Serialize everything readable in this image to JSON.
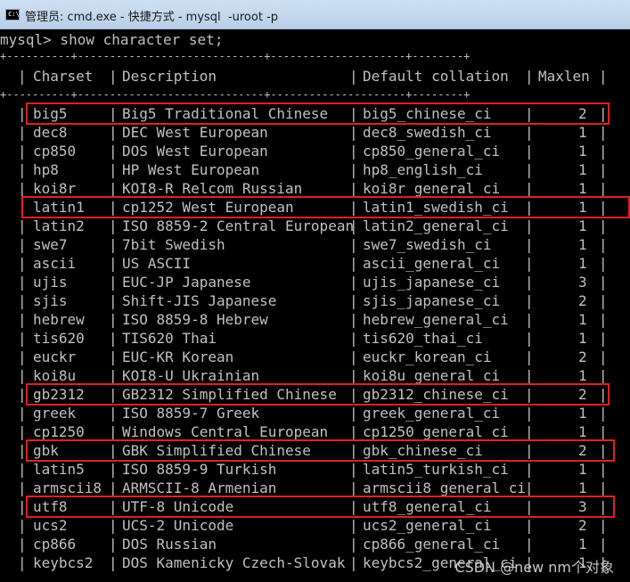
{
  "window": {
    "title_prefix": "管理员: cmd.exe - 快捷方式 - mysql  -uroot -p",
    "icon_text": "C:\\"
  },
  "console": {
    "command_line": "mysql> show character set;",
    "border_line": "+----------+-----------------------------+---------------------+--------+",
    "header": {
      "charset": "Charset",
      "description": "Description",
      "collation": "Default collation",
      "maxlen": "Maxlen"
    },
    "rows": [
      {
        "charset": "big5",
        "description": "Big5 Traditional Chinese",
        "collation": "big5_chinese_ci",
        "maxlen": "2",
        "highlight": true
      },
      {
        "charset": "dec8",
        "description": "DEC West European",
        "collation": "dec8_swedish_ci",
        "maxlen": "1",
        "highlight": false
      },
      {
        "charset": "cp850",
        "description": "DOS West European",
        "collation": "cp850_general_ci",
        "maxlen": "1",
        "highlight": false
      },
      {
        "charset": "hp8",
        "description": "HP West European",
        "collation": "hp8_english_ci",
        "maxlen": "1",
        "highlight": false
      },
      {
        "charset": "koi8r",
        "description": "KOI8-R Relcom Russian",
        "collation": "koi8r_general_ci",
        "maxlen": "1",
        "highlight": false
      },
      {
        "charset": "latin1",
        "description": "cp1252 West European",
        "collation": "latin1_swedish_ci",
        "maxlen": "1",
        "highlight": true
      },
      {
        "charset": "latin2",
        "description": "ISO 8859-2 Central European",
        "collation": "latin2_general_ci",
        "maxlen": "1",
        "highlight": false
      },
      {
        "charset": "swe7",
        "description": "7bit Swedish",
        "collation": "swe7_swedish_ci",
        "maxlen": "1",
        "highlight": false
      },
      {
        "charset": "ascii",
        "description": "US ASCII",
        "collation": "ascii_general_ci",
        "maxlen": "1",
        "highlight": false
      },
      {
        "charset": "ujis",
        "description": "EUC-JP Japanese",
        "collation": "ujis_japanese_ci",
        "maxlen": "3",
        "highlight": false
      },
      {
        "charset": "sjis",
        "description": "Shift-JIS Japanese",
        "collation": "sjis_japanese_ci",
        "maxlen": "2",
        "highlight": false
      },
      {
        "charset": "hebrew",
        "description": "ISO 8859-8 Hebrew",
        "collation": "hebrew_general_ci",
        "maxlen": "1",
        "highlight": false
      },
      {
        "charset": "tis620",
        "description": "TIS620 Thai",
        "collation": "tis620_thai_ci",
        "maxlen": "1",
        "highlight": false
      },
      {
        "charset": "euckr",
        "description": "EUC-KR Korean",
        "collation": "euckr_korean_ci",
        "maxlen": "2",
        "highlight": false
      },
      {
        "charset": "koi8u",
        "description": "KOI8-U Ukrainian",
        "collation": "koi8u_general_ci",
        "maxlen": "1",
        "highlight": false
      },
      {
        "charset": "gb2312",
        "description": "GB2312 Simplified Chinese",
        "collation": "gb2312_chinese_ci",
        "maxlen": "2",
        "highlight": true
      },
      {
        "charset": "greek",
        "description": "ISO 8859-7 Greek",
        "collation": "greek_general_ci",
        "maxlen": "1",
        "highlight": false
      },
      {
        "charset": "cp1250",
        "description": "Windows Central European",
        "collation": "cp1250_general_ci",
        "maxlen": "1",
        "highlight": false
      },
      {
        "charset": "gbk",
        "description": "GBK Simplified Chinese",
        "collation": "gbk_chinese_ci",
        "maxlen": "2",
        "highlight": true
      },
      {
        "charset": "latin5",
        "description": "ISO 8859-9 Turkish",
        "collation": "latin5_turkish_ci",
        "maxlen": "1",
        "highlight": false
      },
      {
        "charset": "armscii8",
        "description": "ARMSCII-8 Armenian",
        "collation": "armscii8_general_ci",
        "maxlen": "1",
        "highlight": false
      },
      {
        "charset": "utf8",
        "description": "UTF-8 Unicode",
        "collation": "utf8_general_ci",
        "maxlen": "3",
        "highlight": true
      },
      {
        "charset": "ucs2",
        "description": "UCS-2 Unicode",
        "collation": "ucs2_general_ci",
        "maxlen": "2",
        "highlight": false
      },
      {
        "charset": "cp866",
        "description": "DOS Russian",
        "collation": "cp866_general_ci",
        "maxlen": "1",
        "highlight": false
      },
      {
        "charset": "keybcs2",
        "description": "DOS Kamenicky Czech-Slovak",
        "collation": "keybcs2_general_ci",
        "maxlen": "1",
        "highlight": false
      }
    ],
    "highlight_color": "#e0201e",
    "text_color": "#c0c0c0",
    "background_color": "#000000"
  },
  "watermark": "CSDN @new nm个对象"
}
